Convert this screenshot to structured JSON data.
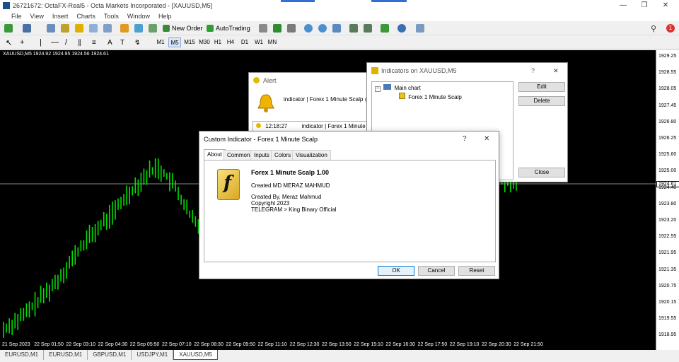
{
  "window": {
    "title": "26721672: OctaFX-Real5 - Octa Markets Incorporated - [XAUUSD,M5]",
    "minimize": "—",
    "restore": "❐",
    "close": "✕"
  },
  "menu": [
    "File",
    "View",
    "Insert",
    "Charts",
    "Tools",
    "Window",
    "Help"
  ],
  "toolbar": {
    "new_order": "New Order",
    "autotrading": "AutoTrading",
    "notification_count": "1"
  },
  "timeframes": [
    "M1",
    "M5",
    "M15",
    "M30",
    "H1",
    "H4",
    "D1",
    "W1",
    "MN"
  ],
  "chart": {
    "symbol_label": "XAUUSD,M5  1924.92 1924.95 1924.56 1924.61",
    "current_price": "1924.61",
    "price_ticks": [
      "1929.25",
      "1928.55",
      "1928.05",
      "1927.45",
      "1926.80",
      "1926.25",
      "1925.60",
      "1925.00",
      "1924.40",
      "1923.80",
      "1923.20",
      "1922.55",
      "1921.95",
      "1921.35",
      "1920.75",
      "1920.15",
      "1919.55",
      "1918.95"
    ],
    "time_ticks": [
      "21 Sep 2023",
      "22 Sep 01:50",
      "22 Sep 03:10",
      "22 Sep 04:30",
      "22 Sep 05:50",
      "22 Sep 07:10",
      "22 Sep 08:30",
      "22 Sep 09:50",
      "22 Sep 11:10",
      "22 Sep 12:30",
      "22 Sep 13:50",
      "22 Sep 15:10",
      "22 Sep 16:30",
      "22 Sep 17:50",
      "22 Sep 19:10",
      "22 Sep 20:30",
      "22 Sep 21:50"
    ],
    "bar_color": "#00e000",
    "background": "#000000"
  },
  "symbol_tabs": [
    "EURUSD,M1",
    "EURUSD,M1",
    "GBPUSD,M1",
    "USDJPY,M1",
    "XAUUSD,M5"
  ],
  "alert": {
    "title": "Alert",
    "message": "indicator | Forex 1 Minute Scalp @",
    "row_time": "12:18:27",
    "row_text": "indicator | Forex 1 Minute S"
  },
  "indicators_window": {
    "title": "Indicators on XAUUSD,M5",
    "help": "?",
    "close": "✕",
    "tree_root": "Main chart",
    "tree_item": "Forex 1 Minute Scalp",
    "edit": "Edit",
    "delete": "Delete",
    "close_button": "Close"
  },
  "custom_indicator": {
    "title": "Custom Indicator - Forex 1 Minute Scalp",
    "help": "?",
    "close": "✕",
    "tabs": [
      "About",
      "Common",
      "Inputs",
      "Colors",
      "Visualization"
    ],
    "name": "Forex 1 Minute Scalp 1.00",
    "created": "Created MD MERAZ MAHMUD",
    "created_by": "Created By, Meraz Mahmud",
    "copyright": "Copyright 2023",
    "telegram": "TELEGRAM > King Binary Official",
    "logo_letter": "f",
    "ok": "OK",
    "cancel": "Cancel",
    "reset": "Reset"
  }
}
